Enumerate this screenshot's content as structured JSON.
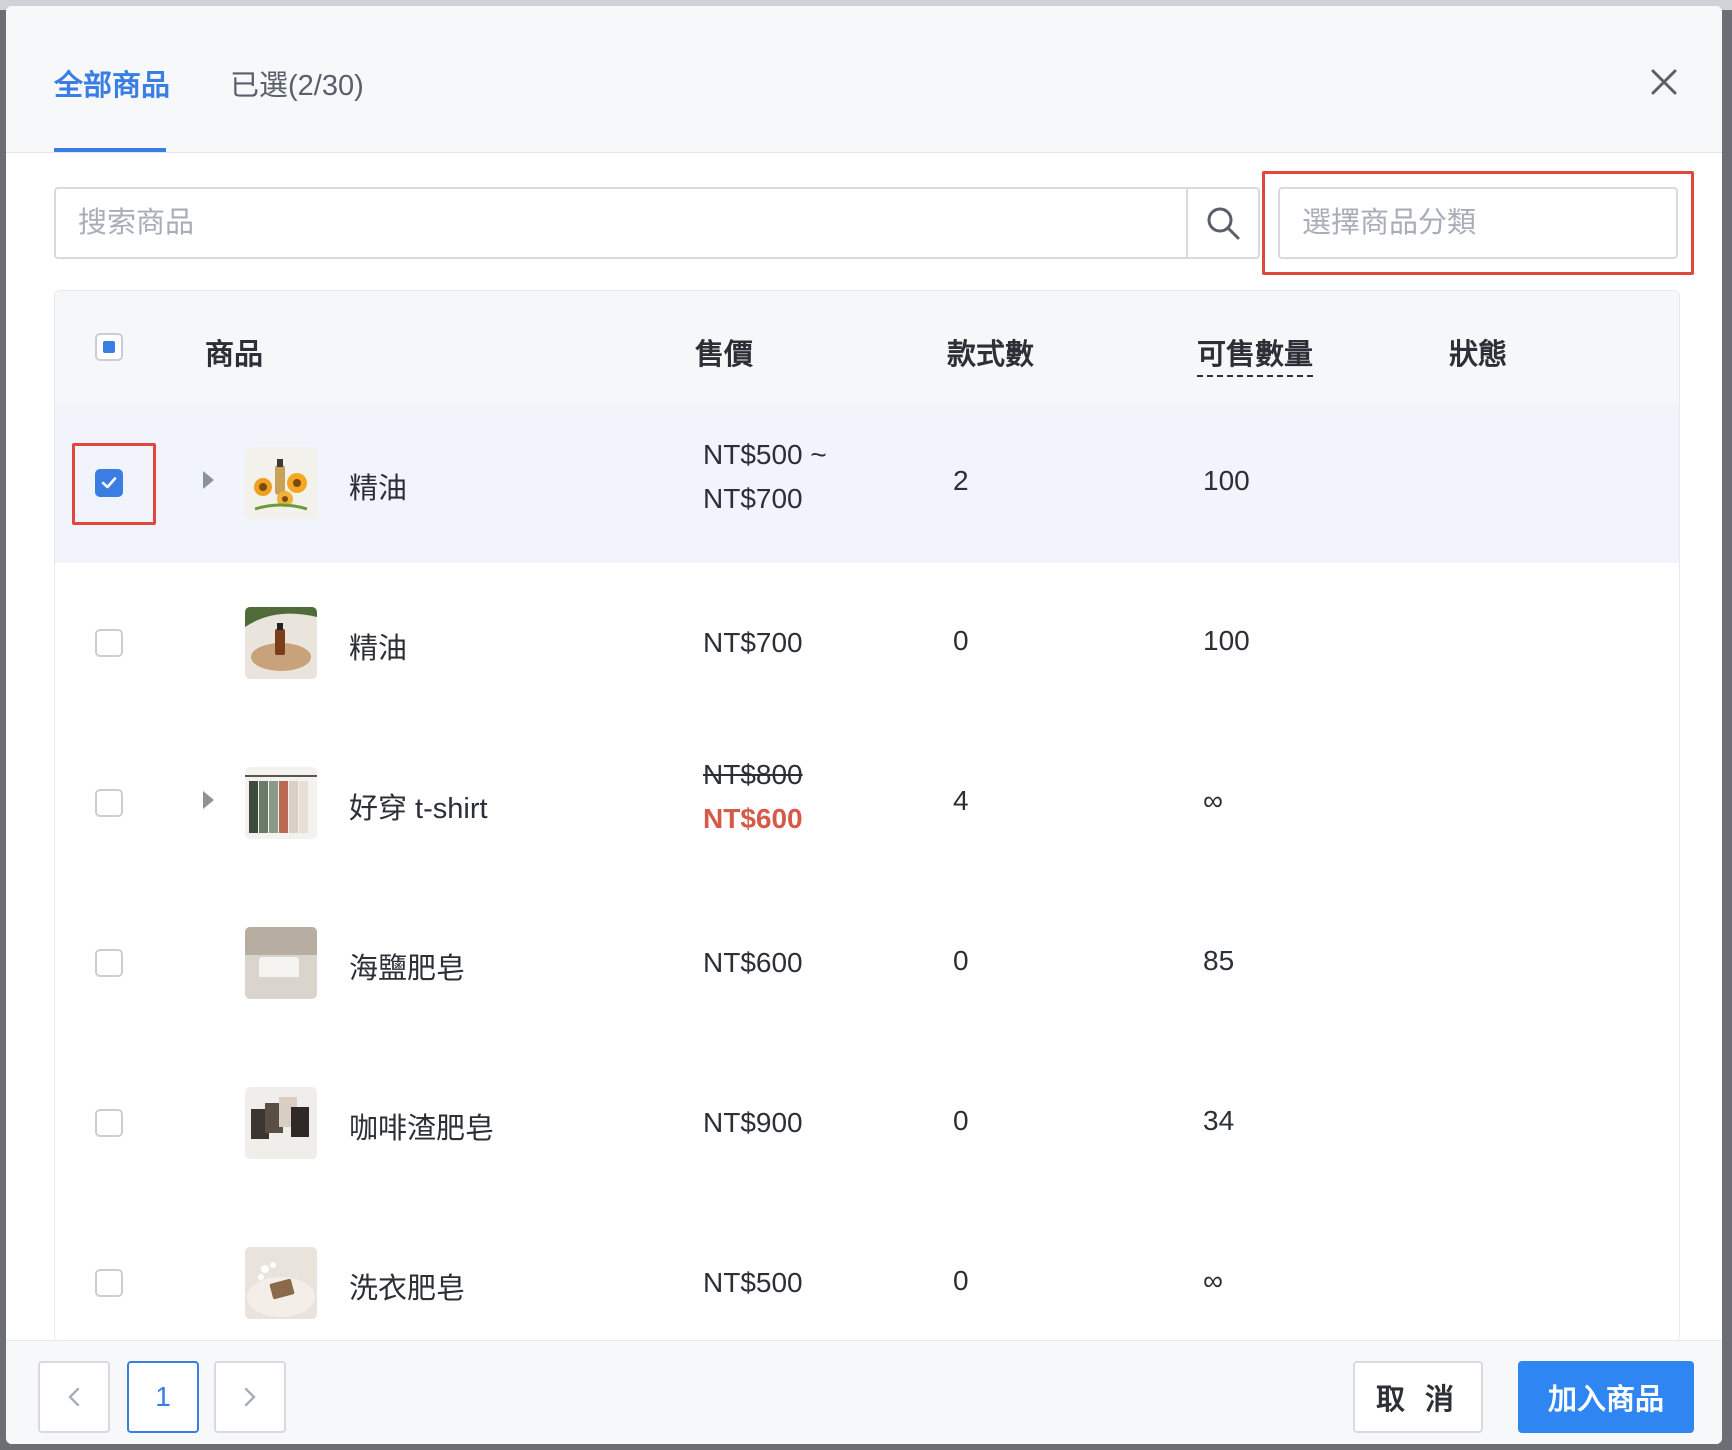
{
  "tabs": {
    "all_label": "全部商品",
    "selected_label": "已選(2/30)"
  },
  "search": {
    "placeholder": "搜索商品"
  },
  "category": {
    "placeholder": "選擇商品分類"
  },
  "table": {
    "headers": {
      "product": "商品",
      "price": "售價",
      "variants": "款式數",
      "available_qty": "可售數量",
      "status": "狀態"
    },
    "rows": [
      {
        "name": "精油",
        "price_line1": "NT$500 ~",
        "price_line2": "NT$700",
        "variants": "2",
        "qty": "100",
        "checked": true,
        "expandable": true
      },
      {
        "name": "精油",
        "price_line1": "NT$700",
        "variants": "0",
        "qty": "100",
        "checked": false,
        "expandable": false
      },
      {
        "name": "好穿 t-shirt",
        "price_original": "NT$800",
        "price_sale": "NT$600",
        "variants": "4",
        "qty": "∞",
        "checked": false,
        "expandable": true
      },
      {
        "name": "海鹽肥皂",
        "price_line1": "NT$600",
        "variants": "0",
        "qty": "85",
        "checked": false,
        "expandable": false
      },
      {
        "name": "咖啡渣肥皂",
        "price_line1": "NT$900",
        "variants": "0",
        "qty": "34",
        "checked": false,
        "expandable": false
      },
      {
        "name": "洗衣肥皂",
        "price_line1": "NT$500",
        "variants": "0",
        "qty": "∞",
        "checked": false,
        "expandable": false
      }
    ]
  },
  "pagination": {
    "current_page": "1",
    "prev_icon": "chevron-left-icon",
    "next_icon": "chevron-right-icon"
  },
  "buttons": {
    "cancel": "取 消",
    "add": "加入商品"
  },
  "colors": {
    "accent": "#3a7ee4",
    "sale": "#d65a4a",
    "primary_button": "#2f86f2",
    "highlight": "#e0483e"
  }
}
